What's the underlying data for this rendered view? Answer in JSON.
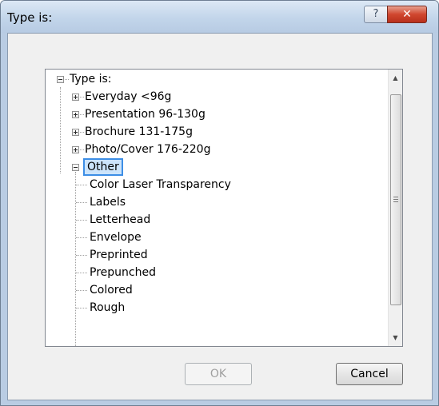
{
  "window": {
    "title": "Type is:"
  },
  "tree": {
    "root": "Type is:",
    "items": [
      "Everyday <96g",
      "Presentation 96-130g",
      "Brochure 131-175g",
      "Photo/Cover 176-220g",
      "Other"
    ],
    "selected": "Other",
    "children": [
      "Color Laser Transparency",
      "Labels",
      "Letterhead",
      "Envelope",
      "Preprinted",
      "Prepunched",
      "Colored",
      "Rough"
    ]
  },
  "buttons": {
    "ok": "OK",
    "cancel": "Cancel"
  }
}
